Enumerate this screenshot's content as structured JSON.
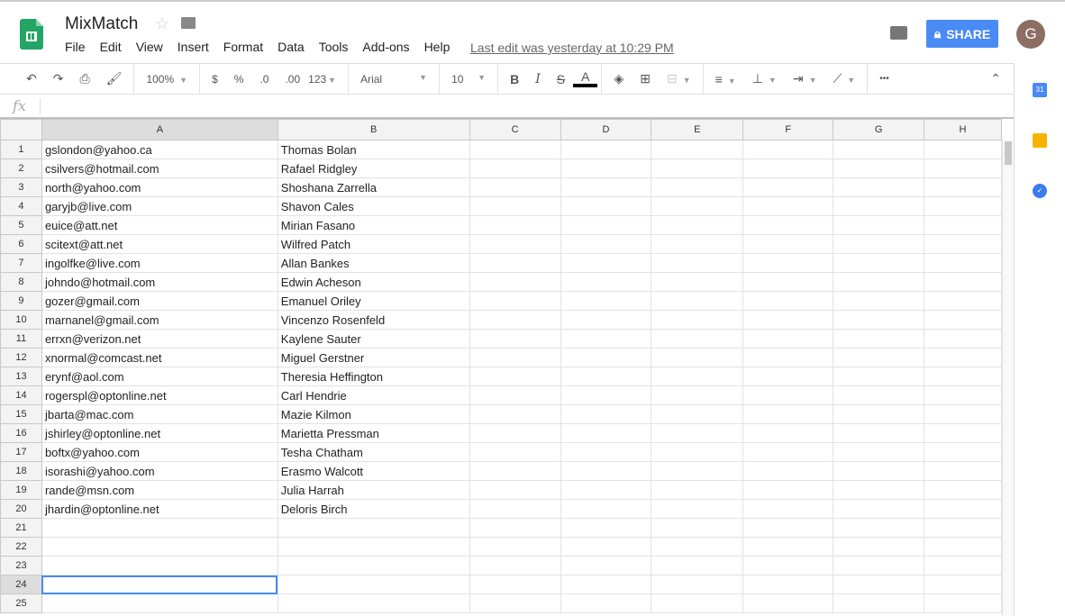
{
  "doc": {
    "title": "MixMatch",
    "last_edit": "Last edit was yesterday at 10:29 PM"
  },
  "menu": [
    "File",
    "Edit",
    "View",
    "Insert",
    "Format",
    "Data",
    "Tools",
    "Add-ons",
    "Help"
  ],
  "share_label": "SHARE",
  "avatar_letter": "G",
  "toolbar": {
    "zoom": "100%",
    "currency": "$",
    "percent": "%",
    "dec_less": ".0",
    "dec_more": ".00",
    "format": "123",
    "font": "Arial",
    "size": "10",
    "bold": "B",
    "italic": "I",
    "strike": "S",
    "textcolor": "A",
    "more": "•••"
  },
  "fx": "fx",
  "calendar_label": "31",
  "columns": [
    "A",
    "B",
    "C",
    "D",
    "E",
    "F",
    "G",
    "H"
  ],
  "rows": [
    [
      "gslondon@yahoo.ca",
      "Thomas Bolan"
    ],
    [
      "csilvers@hotmail.com",
      "Rafael Ridgley"
    ],
    [
      "north@yahoo.com",
      "Shoshana Zarrella"
    ],
    [
      "garyjb@live.com",
      "Shavon Cales"
    ],
    [
      "euice@att.net",
      "Mirian Fasano"
    ],
    [
      "scitext@att.net",
      "Wilfred Patch"
    ],
    [
      "ingolfke@live.com",
      "Allan Bankes"
    ],
    [
      "johndo@hotmail.com",
      "Edwin Acheson"
    ],
    [
      "gozer@gmail.com",
      "Emanuel Oriley"
    ],
    [
      "marnanel@gmail.com",
      "Vincenzo Rosenfeld"
    ],
    [
      "errxn@verizon.net",
      "Kaylene Sauter"
    ],
    [
      "xnormal@comcast.net",
      "Miguel Gerstner"
    ],
    [
      "erynf@aol.com",
      "Theresia Heffington"
    ],
    [
      "rogerspl@optonline.net",
      "Carl Hendrie"
    ],
    [
      "jbarta@mac.com",
      "Mazie Kilmon"
    ],
    [
      "jshirley@optonline.net",
      "Marietta Pressman"
    ],
    [
      "boftx@yahoo.com",
      "Tesha Chatham"
    ],
    [
      "isorashi@yahoo.com",
      "Erasmo Walcott"
    ],
    [
      "rande@msn.com",
      "Julia Harrah"
    ],
    [
      "jhardin@optonline.net",
      "Deloris Birch"
    ],
    [
      "",
      ""
    ],
    [
      "",
      ""
    ],
    [
      "",
      ""
    ],
    [
      "",
      ""
    ],
    [
      "",
      ""
    ]
  ],
  "active_row": 24,
  "colors": {
    "accent": "#4a8af4"
  }
}
